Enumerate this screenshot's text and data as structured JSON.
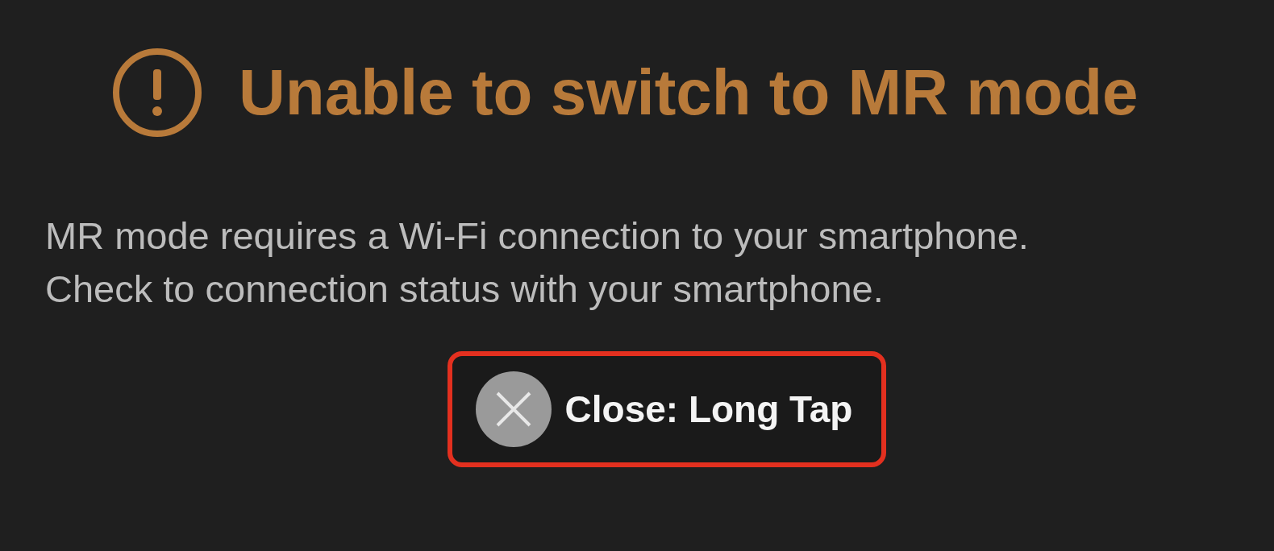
{
  "dialog": {
    "title": "Unable to switch to MR mode",
    "message": [
      "MR mode requires a Wi-Fi connection to your smartphone.",
      "Check to connection status with your smartphone."
    ],
    "close_button": {
      "label": "Close: Long Tap",
      "highlighted": true
    }
  }
}
